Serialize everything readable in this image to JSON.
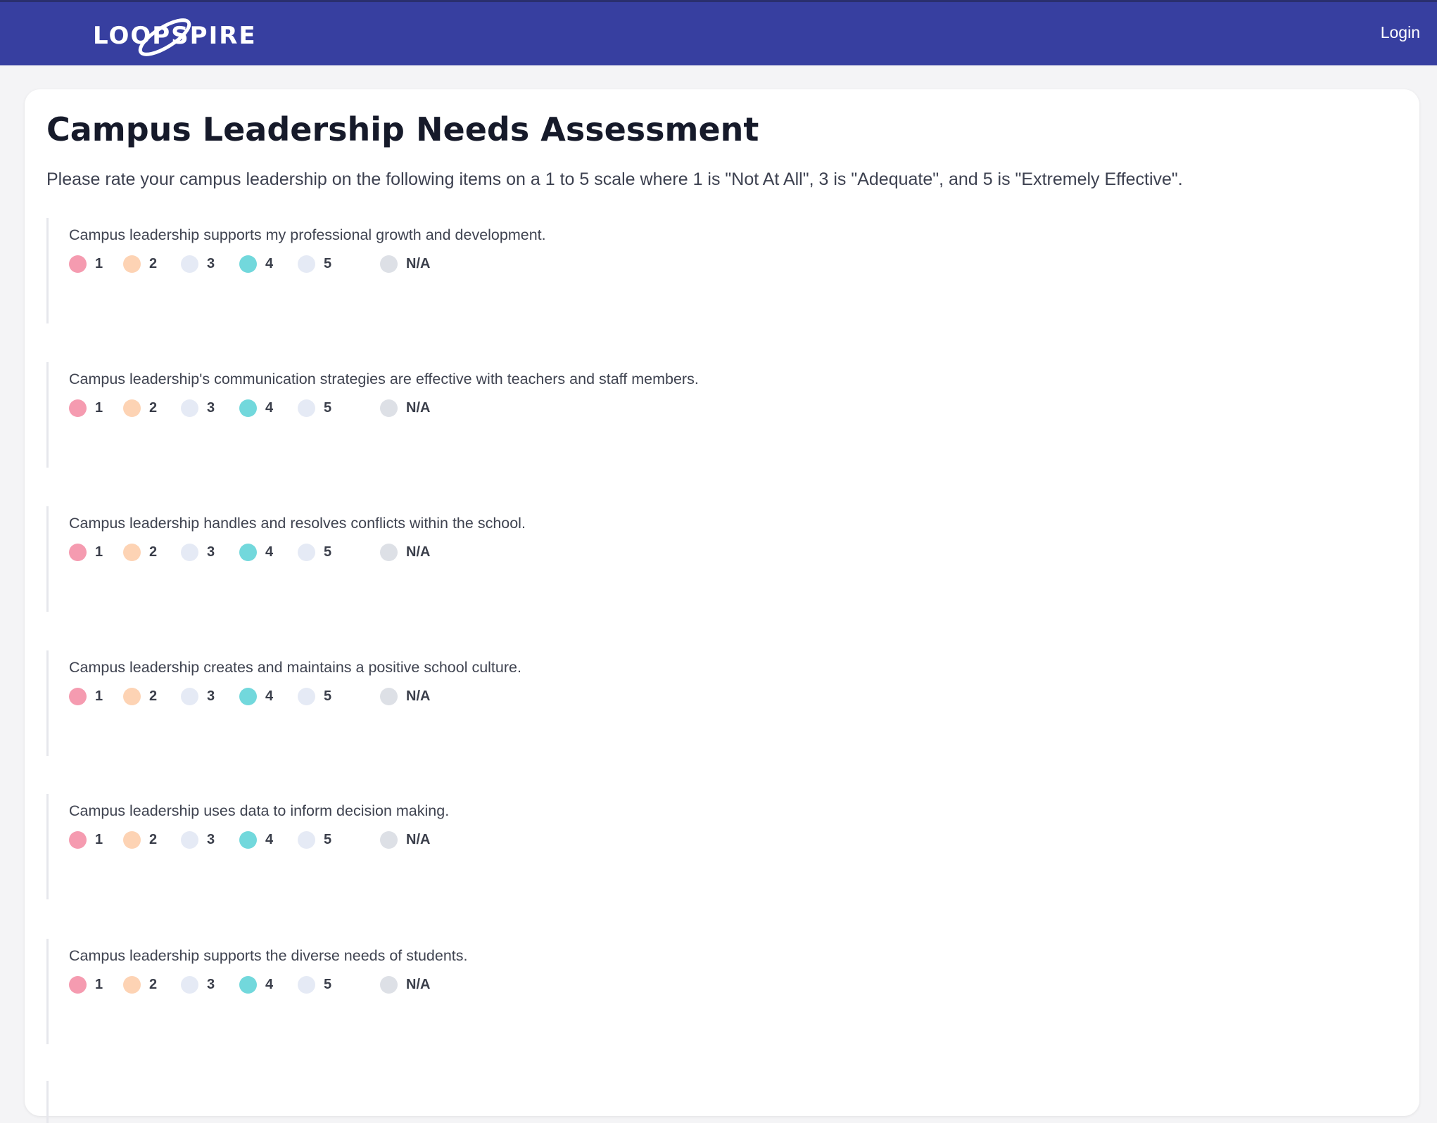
{
  "header": {
    "logo_text": "LOOPSPIRE",
    "login_label": "Login"
  },
  "page": {
    "title": "Campus Leadership Needs Assessment",
    "instructions": "Please rate your campus leadership on the following items on a 1 to 5 scale where 1 is \"Not At All\", 3 is \"Adequate\", and 5 is \"Extremely Effective\"."
  },
  "scale": {
    "options": [
      {
        "label": "1",
        "color": "#f59bb0"
      },
      {
        "label": "2",
        "color": "#fdd3b4"
      },
      {
        "label": "3",
        "color": "#e5eaf5"
      },
      {
        "label": "4",
        "color": "#72d8dc"
      },
      {
        "label": "5",
        "color": "#e5eaf5"
      },
      {
        "label": "N/A",
        "color": "#dde0e6"
      }
    ]
  },
  "questions": [
    {
      "text": "Campus leadership supports my professional growth and development."
    },
    {
      "text": "Campus leadership's communication strategies are effective with teachers and staff members."
    },
    {
      "text": "Campus leadership handles and resolves conflicts within the school."
    },
    {
      "text": "Campus leadership creates and maintains a positive school culture."
    },
    {
      "text": "Campus leadership uses data to inform decision making."
    },
    {
      "text": "Campus leadership supports the diverse needs of students."
    }
  ]
}
